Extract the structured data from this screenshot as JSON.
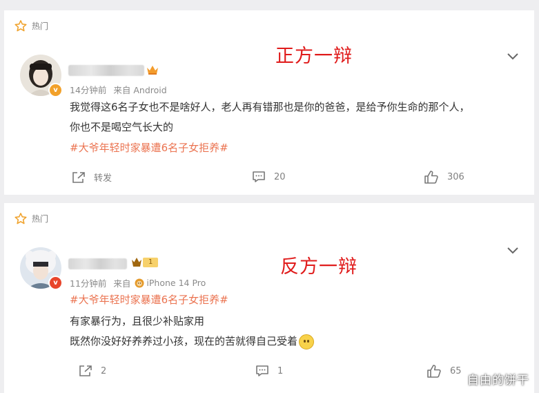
{
  "posts": [
    {
      "tag": "热门",
      "caption": "正方一辩",
      "time": "14分钟前",
      "source": "来自 Android",
      "content_lines": [
        "我觉得这6名子女也不是啥好人，老人再有错那也是你的爸爸，是给予你生命的那个人，",
        "你也不是喝空气长大的"
      ],
      "hashtag": "#大爷年轻时家暴遭6名子女拒养#",
      "actions": {
        "repost": "转发",
        "comments": "20",
        "likes": "306"
      },
      "accent": "#eb7350"
    },
    {
      "tag": "热门",
      "caption": "反方一辩",
      "time": "11分钟前",
      "source": "来自",
      "device": "iPhone 14 Pro",
      "level": "1",
      "hashtag": "#大爷年轻时家暴遭6名子女拒养#",
      "content_lines": [
        "有家暴行为，且很少补贴家用",
        "既然你没好好养养过小孩，现在的苦就得自己受着"
      ],
      "actions": {
        "repost": "2",
        "comments": "1",
        "likes": "65"
      }
    }
  ],
  "watermark": "自由的饼干"
}
